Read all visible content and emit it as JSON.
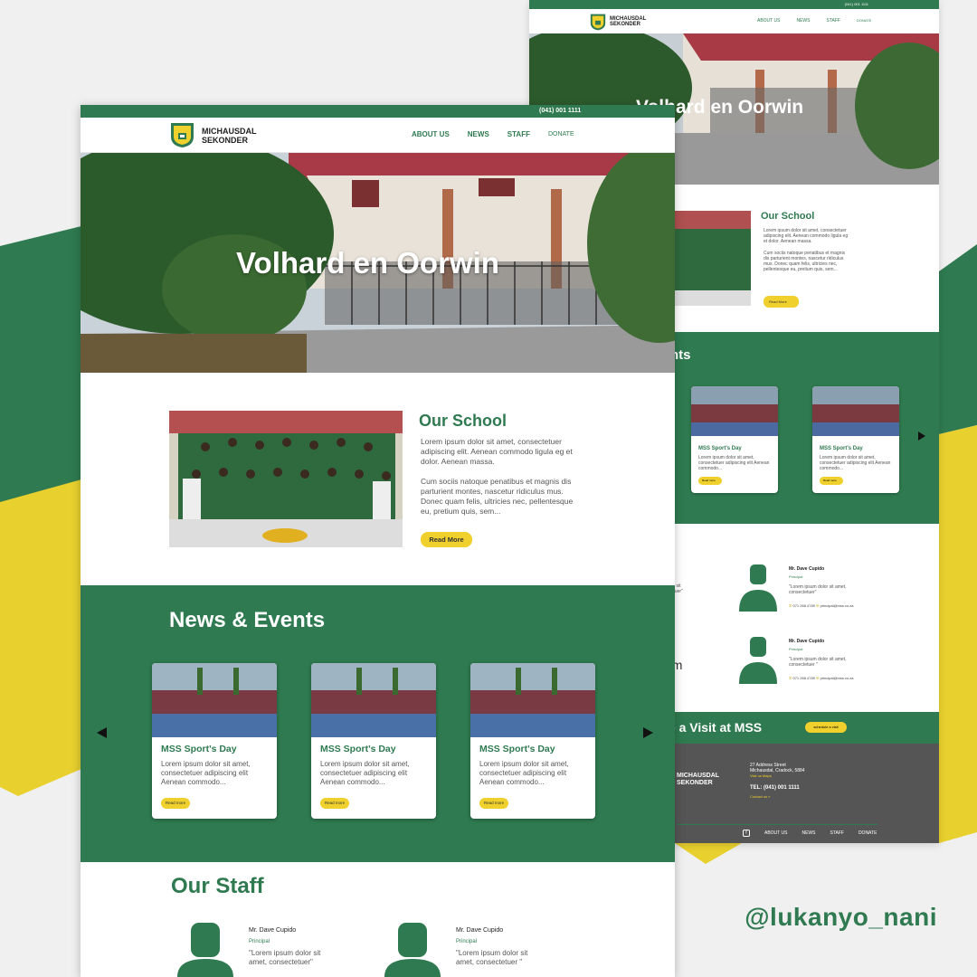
{
  "brand": {
    "green": "#2f7a50",
    "yellow": "#f0d02c",
    "dark": "#555555"
  },
  "school": {
    "name_line1": "MICHAUSDAL",
    "name_line2": "SEKONDER",
    "phone": "(041) 001 1111"
  },
  "nav": {
    "about": "ABOUT US",
    "news": "NEWS",
    "staff": "STAFF",
    "donate": "DONATE"
  },
  "hero": {
    "title": "Volhard en Oorwin"
  },
  "about": {
    "title": "Our School",
    "p1": "Lorem ipsum dolor sit amet, consectetuer adipiscing elit. Aenean commodo ligula eg et dolor. Aenean massa.",
    "p2": "Cum sociis natoque penatibus et magnis dis parturient montes, nascetur ridiculus mus. Donec quam felis, ultricies nec, pellentesque eu, pretium quis, sem...",
    "read_more": "Read More"
  },
  "news": {
    "title": "News & Events",
    "cards": [
      {
        "title": "MSS Sport's Day",
        "desc": "Lorem ipsum dolor sit amet, consectetuer adipiscing elit Aenean commodo...",
        "btn": "Read more"
      },
      {
        "title": "MSS Sport's Day",
        "desc": "Lorem ipsum dolor sit amet, consectetuer adipiscing elit Aenean commodo...",
        "btn": "Read more"
      },
      {
        "title": "MSS Sport's Day",
        "desc": "Lorem ipsum dolor sit amet, consectetuer adipiscing elit Aenean commodo...",
        "btn": "Read more"
      }
    ]
  },
  "staff": {
    "title": "Our Staff",
    "members": [
      {
        "name": "Mr. Dave Cupido",
        "role": "Principal",
        "quote": "\"Lorem ipsum dolor sit amet, consectetuer\"",
        "phone": "071 268 4789",
        "email": "principal@mss.co.za"
      },
      {
        "name": "Mr. Dave Cupido",
        "role": "Principal",
        "quote": "\"Lorem ipsum dolor sit amet, consectetuer \"",
        "phone": "071 268 4789",
        "email": "principal@mss.co.za"
      }
    ]
  },
  "back": {
    "partial_news_title": "nts",
    "partial_staff_quote": "dolor sit\nectetuer\"",
    "partial_staff_quote2": "em",
    "visit": "le a Visit at MSS",
    "visit_btn": "schedule a visit",
    "address_line1": "27 Address Street",
    "address_line2": "Michausdal, Cradock, 5884",
    "email_label": "Visit us Maps",
    "tel": "TEL: (041) 001 1111",
    "contact_label": "Contact us »",
    "fb": "f"
  },
  "credit": {
    "handle": "@lukanyo_nani"
  }
}
